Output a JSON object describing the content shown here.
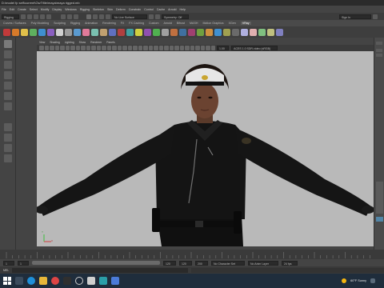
{
  "window": {
    "title": "D:\\model fp self\\current\\Ow7\\file\\maya\\maya rigged.mb"
  },
  "menu": [
    "File",
    "Edit",
    "Create",
    "Select",
    "Modify",
    "Display",
    "Windows",
    "Rigging",
    "Skeleton",
    "Skin",
    "Deform",
    "Constrain",
    "Control",
    "Cache",
    "Arnold",
    "Help"
  ],
  "statusline": {
    "mode": "Rigging",
    "search": "No Live Surface",
    "symmetry": "Symmetry: Off",
    "sign_in": "Sign In"
  },
  "shelf_tabs": [
    "Curves / Surfaces",
    "Poly Modeling",
    "Sculpting",
    "Rigging",
    "Animation",
    "Rendering",
    "FX",
    "FX Caching",
    "Custom",
    "Arnold",
    "Bifrost",
    "MASH",
    "Motion Graphics",
    "XGen",
    "VRay"
  ],
  "active_shelf_tab": "VRay",
  "panel_menu": [
    "View",
    "Shading",
    "Lighting",
    "Show",
    "Renderer",
    "Panels"
  ],
  "panel_toolbar": {
    "gamma": "1.00",
    "colorspace": "ACES 1.0 SDR-video (sRGB)"
  },
  "axis": {
    "y": "Y",
    "x": "X"
  },
  "range": {
    "start": "1",
    "start2": "1",
    "end": "120",
    "end2": "120",
    "end3": "200",
    "character_set": "No Character Set",
    "anim_layer": "No Anim Layer",
    "fps": "24 fps"
  },
  "cmdline": {
    "label": "MEL"
  },
  "taskbar": {
    "weather": "60°F Sunny",
    "search_placeholder": "Type here to search"
  },
  "colors": {
    "viewport_bg": "#b9b9b9",
    "accent": "#5285a6"
  }
}
